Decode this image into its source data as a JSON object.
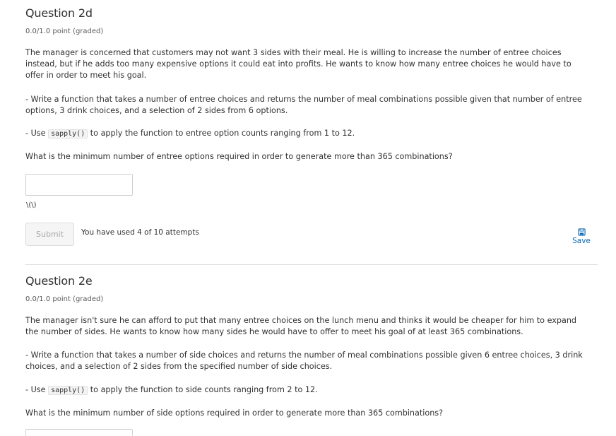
{
  "q2d": {
    "title": "Question 2d",
    "points": "0.0/1.0 point (graded)",
    "para1": "The manager is concerned that customers may not want 3 sides with their meal. He is willing to increase the number of entree choices instead, but if he adds too many expensive options it could eat into profits. He wants to know how many entree choices he would have to offer in order to meet his goal.",
    "para2": "- Write a function that takes a number of entree choices and returns the number of meal combinations possible given that number of entree options, 3 drink choices, and a selection of 2 sides from 6 options.",
    "para3_pre": "- Use ",
    "para3_code": "sapply()",
    "para3_post": " to apply the function to entree option counts ranging from 1 to 12.",
    "question": "What is the minimum number of entree options required in order to generate more than 365 combinations?",
    "input_value": "",
    "preview": "\\(\\)",
    "submit_label": "Submit",
    "attempts": "You have used 4 of 10 attempts",
    "save_label": "Save"
  },
  "q2e": {
    "title": "Question 2e",
    "points": "0.0/1.0 point (graded)",
    "para1": "The manager isn't sure he can afford to put that many entree choices on the lunch menu and thinks it would be cheaper for him to expand the number of sides. He wants to know how many sides he would have to offer to meet his goal of at least 365 combinations.",
    "para2": "- Write a function that takes a number of side choices and returns the number of meal combinations possible given 6 entree choices, 3 drink choices, and a selection of 2 sides from the specified number of side choices.",
    "para3_pre": "- Use ",
    "para3_code": "sapply()",
    "para3_post": " to apply the function to side counts ranging from 2 to 12.",
    "question": "What is the minimum number of side options required in order to generate more than 365 combinations?"
  },
  "colors": {
    "link": "#0a6ab6",
    "text": "#313131",
    "divider": "#dddddd"
  }
}
